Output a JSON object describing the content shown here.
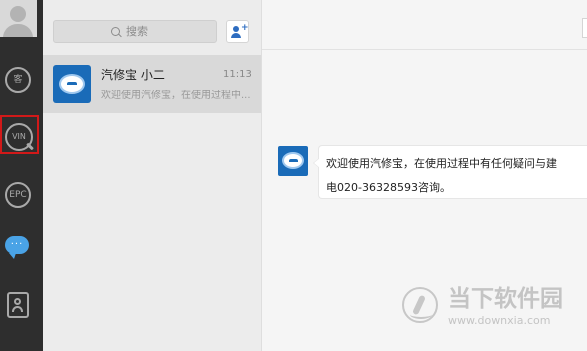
{
  "sidebar": {
    "items": [
      {
        "label": "客",
        "icon": "customer-icon"
      },
      {
        "label": "VIN",
        "icon": "vin-search-icon",
        "selected": true
      },
      {
        "label": "EPC",
        "icon": "epc-icon"
      },
      {
        "label": "",
        "icon": "chat-bubble-icon",
        "active": true
      },
      {
        "label": "",
        "icon": "contacts-icon"
      }
    ],
    "highlight_color": "#d11919"
  },
  "search": {
    "placeholder": "搜索"
  },
  "conversation": {
    "name": "汽修宝 小二",
    "time": "11:13",
    "preview": "欢迎使用汽修宝，在使用过程中..."
  },
  "chat": {
    "message": {
      "line1": "欢迎使用汽修宝，在使用过程中有任何疑问与建",
      "line2": "电020-36328593咨询。"
    }
  },
  "watermark": {
    "name": "当下软件园",
    "url": "www.downxia.com"
  },
  "colors": {
    "accent": "#1a6bb8",
    "sidebar_bg": "#2e2e2e",
    "active_icon": "#4aa3e6"
  }
}
